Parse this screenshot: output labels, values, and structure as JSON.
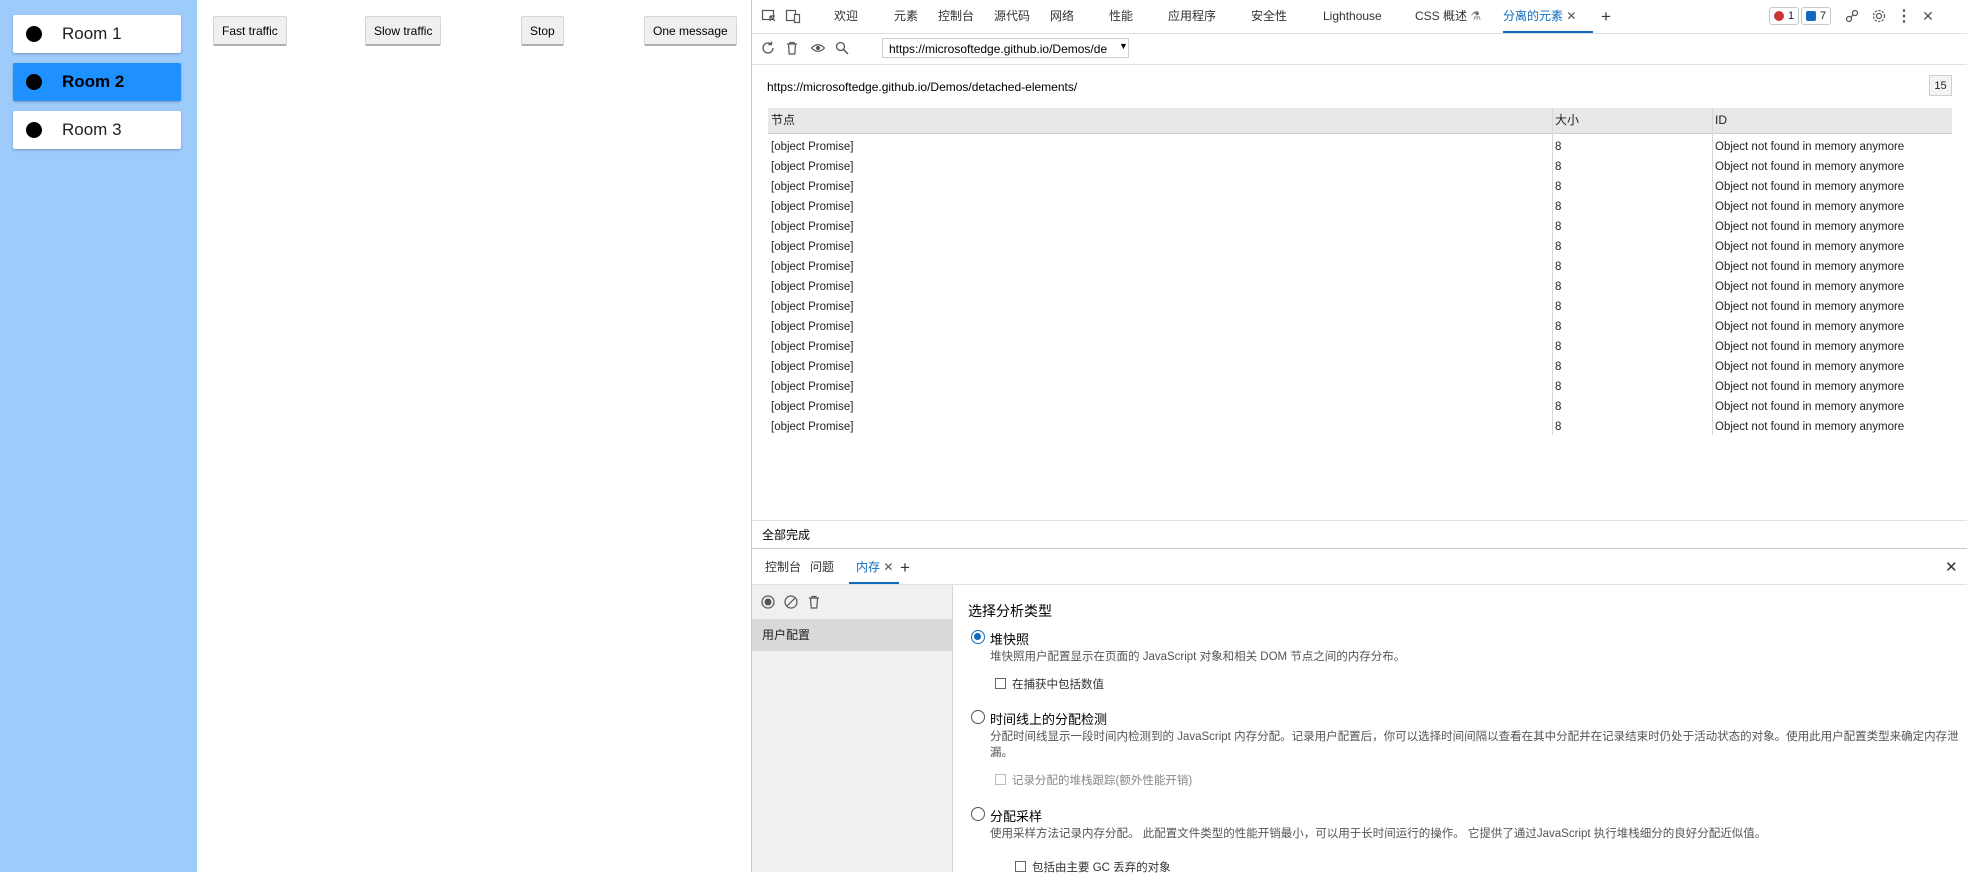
{
  "rooms": [
    {
      "label": "Room 1",
      "active": false
    },
    {
      "label": "Room 2",
      "active": true
    },
    {
      "label": "Room 3",
      "active": false
    }
  ],
  "demo_buttons": [
    "Fast traffic",
    "Slow traffic",
    "Stop",
    "One message"
  ],
  "devtools": {
    "tabs": [
      "欢迎",
      "元素",
      "控制台",
      "源代码",
      "网络",
      "性能",
      "应用程序",
      "安全性",
      "Lighthouse",
      "CSS 概述",
      "分离的元素"
    ],
    "active_tab": "分离的元素",
    "error_count": "1",
    "message_count": "7",
    "url_input": "https://microsoftedge.github.io/Demos/de",
    "page_url": "https://microsoftedge.github.io/Demos/detached-elements/",
    "node_count": "15",
    "table": {
      "columns": [
        "节点",
        "大小",
        "ID"
      ],
      "rows": [
        [
          "[object Promise]",
          "8",
          "Object not found in memory anymore"
        ],
        [
          "[object Promise]",
          "8",
          "Object not found in memory anymore"
        ],
        [
          "[object Promise]",
          "8",
          "Object not found in memory anymore"
        ],
        [
          "[object Promise]",
          "8",
          "Object not found in memory anymore"
        ],
        [
          "[object Promise]",
          "8",
          "Object not found in memory anymore"
        ],
        [
          "[object Promise]",
          "8",
          "Object not found in memory anymore"
        ],
        [
          "[object Promise]",
          "8",
          "Object not found in memory anymore"
        ],
        [
          "[object Promise]",
          "8",
          "Object not found in memory anymore"
        ],
        [
          "[object Promise]",
          "8",
          "Object not found in memory anymore"
        ],
        [
          "[object Promise]",
          "8",
          "Object not found in memory anymore"
        ],
        [
          "[object Promise]",
          "8",
          "Object not found in memory anymore"
        ],
        [
          "[object Promise]",
          "8",
          "Object not found in memory anymore"
        ],
        [
          "[object Promise]",
          "8",
          "Object not found in memory anymore"
        ],
        [
          "[object Promise]",
          "8",
          "Object not found in memory anymore"
        ],
        [
          "[object Promise]",
          "8",
          "Object not found in memory anymore"
        ]
      ]
    },
    "status": "全部完成",
    "drawer_tabs": [
      "控制台",
      "问题",
      "内存"
    ],
    "drawer_active": "内存",
    "memory": {
      "sidebar_label": "用户配置",
      "heading": "选择分析类型",
      "options": [
        {
          "title": "堆快照",
          "selected": true,
          "desc": "堆快照用户配置显示在页面的 JavaScript 对象和相关 DOM 节点之间的内存分布。",
          "checkbox": "在捕获中包括数值",
          "checkbox_disabled": false
        },
        {
          "title": "时间线上的分配检测",
          "selected": false,
          "desc": "分配时间线显示一段时间内检测到的 JavaScript 内存分配。记录用户配置后，你可以选择时间间隔以查看在其中分配并在记录结束时仍处于活动状态的对象。使用此用户配置类型来确定内存泄漏。",
          "checkbox": "记录分配的堆栈跟踪(额外性能开销)",
          "checkbox_disabled": true
        },
        {
          "title": "分配采样",
          "selected": false,
          "desc": "使用采样方法记录内存分配。 此配置文件类型的性能开销最小，可以用于长时间运行的操作。 它提供了通过JavaScript 执行堆栈细分的良好分配近似值。",
          "checkbox": "包括由主要 GC 丢弃的对象",
          "checkbox_disabled": false
        }
      ]
    }
  },
  "colors": {
    "sidebar_bg": "#9dcbfa",
    "active_room": "#1e90ff",
    "accent": "#0f6cbd",
    "error": "#d13438"
  }
}
